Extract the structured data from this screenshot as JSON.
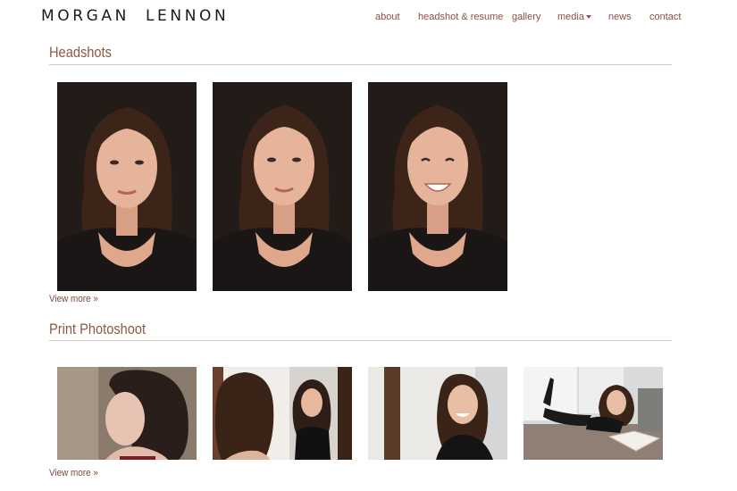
{
  "header": {
    "logo_text": "MORGAN  LENNON",
    "nav": [
      "about",
      "headshot & resume",
      "gallery",
      "media",
      "news",
      "contact"
    ]
  },
  "sections": [
    {
      "title": "Headshots",
      "view_more": "View more »",
      "photos": [
        "headshot-1",
        "headshot-2",
        "headshot-3"
      ]
    },
    {
      "title": "Print Photoshoot",
      "view_more": "View more »",
      "photos": [
        "print-profile",
        "print-mirror",
        "print-smile",
        "print-reading"
      ]
    }
  ],
  "colors": {
    "accent": "#8a5040",
    "rule": "#e2c6b8",
    "logo": "#1a1a1a"
  }
}
